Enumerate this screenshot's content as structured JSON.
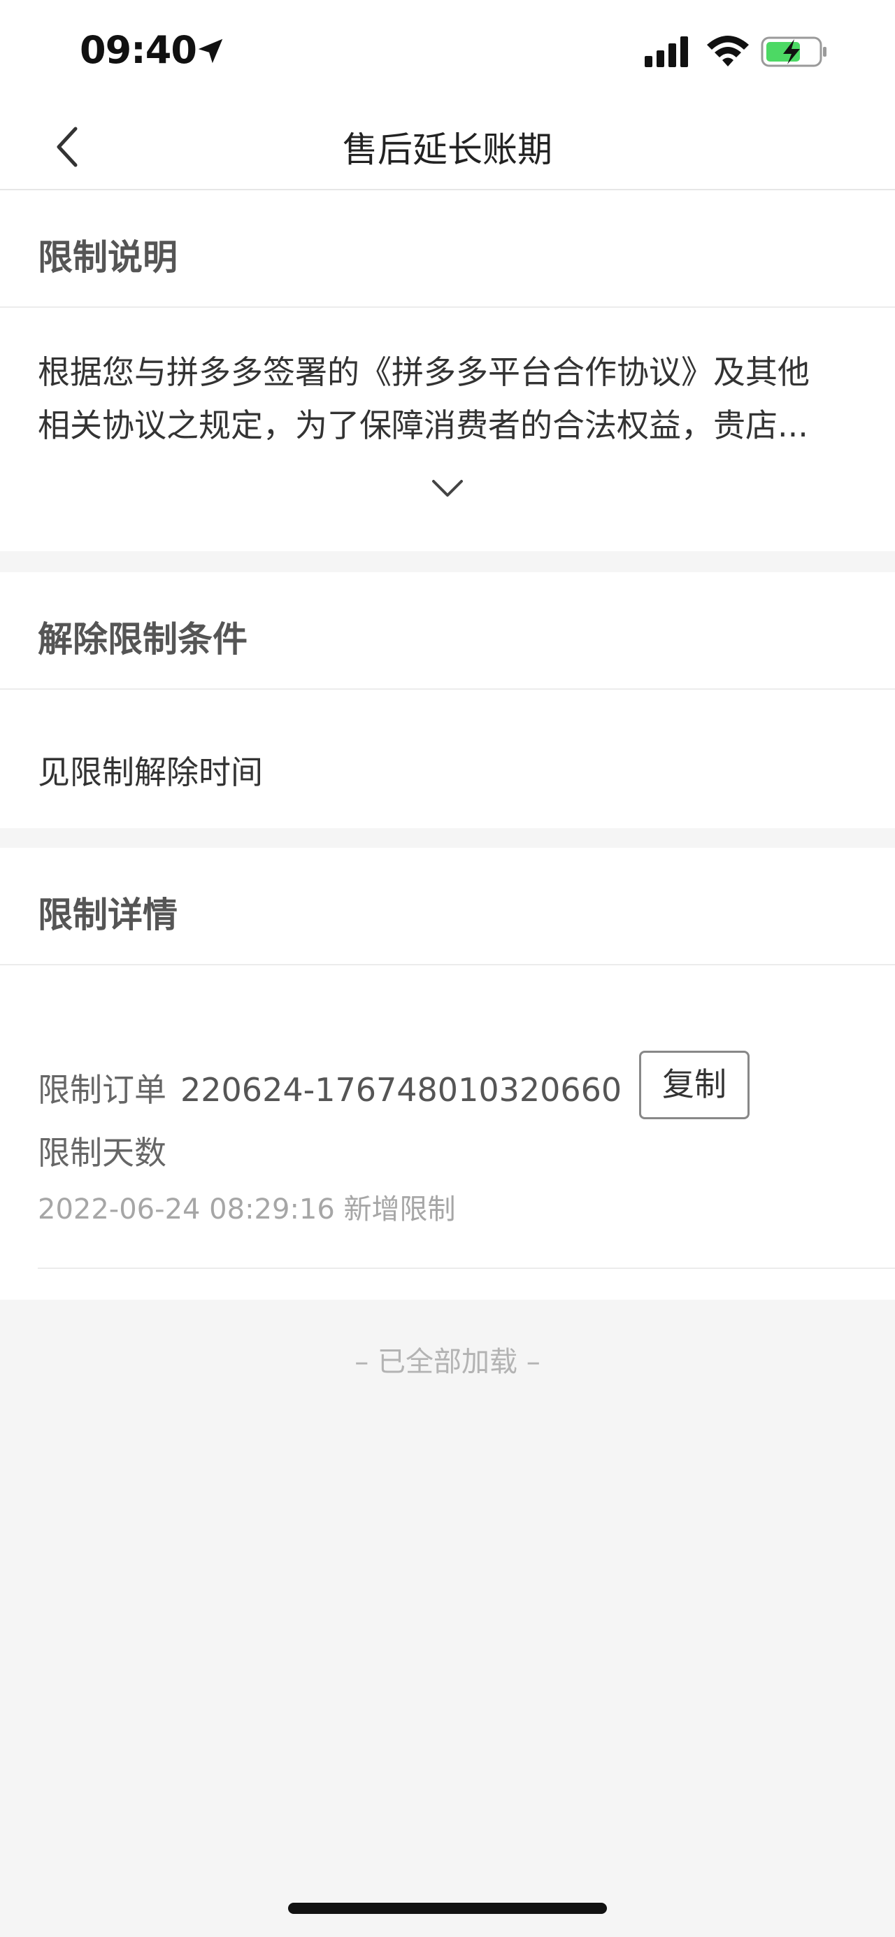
{
  "status_bar": {
    "time": "09:40",
    "icons": [
      "location-arrow-icon",
      "signal-icon",
      "wifi-icon",
      "battery-charging-icon"
    ],
    "battery_color": "#4cd964"
  },
  "nav": {
    "back_icon": "chevron-left-icon",
    "title": "售后延长账期"
  },
  "restriction_description": {
    "title": "限制说明",
    "lines": [
      "根据您与拼多多签署的《拼多多平台合作协议》及其他",
      "相关协议之规定，为了保障消费者的合法权益，贵店..."
    ],
    "expand_icon": "chevron-down-icon"
  },
  "unlock_conditions": {
    "title": "解除限制条件",
    "text": "见限制解除时间"
  },
  "restriction_details": {
    "title": "限制详情",
    "order_label": "限制订单",
    "order_number": "220624-176748010320660",
    "copy_label": "复制",
    "days_label": "限制天数",
    "timestamp": "2022-06-24 08:29:16 新增限制"
  },
  "footer": {
    "loaded_all": "– 已全部加载 –"
  }
}
